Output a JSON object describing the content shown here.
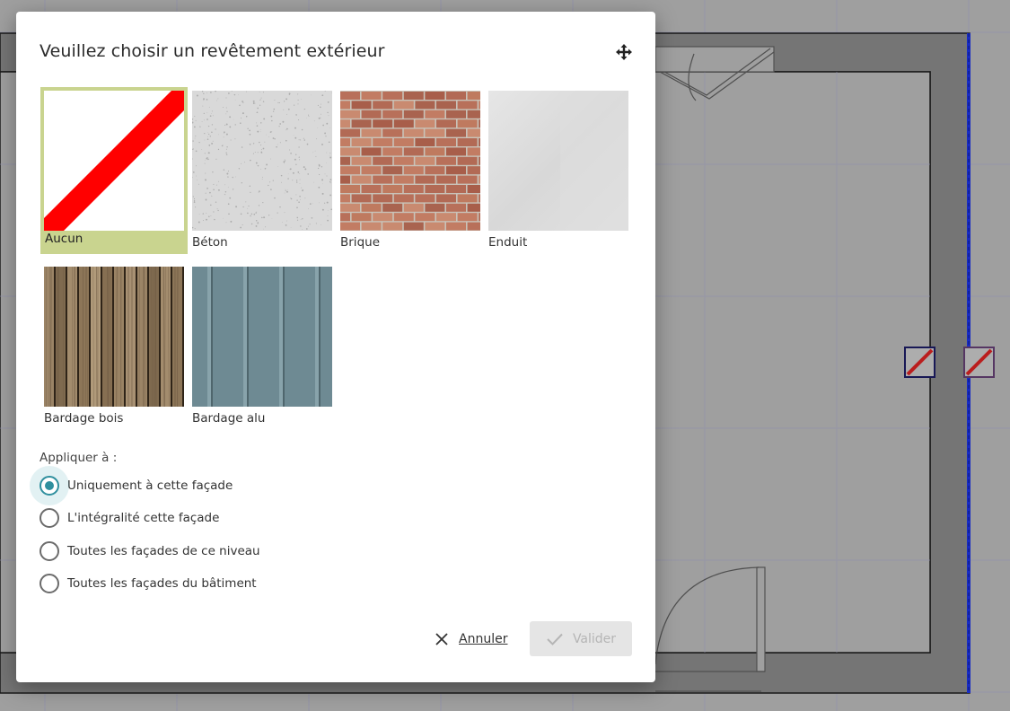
{
  "dialog": {
    "title": "Veuillez choisir un revêtement extérieur",
    "move_icon": "move-arrows-icon"
  },
  "materials": [
    {
      "label": "Aucun",
      "selected": true,
      "texture": "none-red-diagonal"
    },
    {
      "label": "Béton",
      "selected": false,
      "texture": "concrete"
    },
    {
      "label": "Brique",
      "selected": false,
      "texture": "brick"
    },
    {
      "label": "Enduit",
      "selected": false,
      "texture": "render"
    },
    {
      "label": "Bardage bois",
      "selected": false,
      "texture": "wood-cladding"
    },
    {
      "label": "Bardage alu",
      "selected": false,
      "texture": "aluminium-cladding"
    }
  ],
  "apply": {
    "label": "Appliquer à :",
    "options": [
      {
        "label": "Uniquement à cette façade",
        "checked": true
      },
      {
        "label": "L'intégralité cette façade",
        "checked": false
      },
      {
        "label": "Toutes les façades de ce niveau",
        "checked": false
      },
      {
        "label": "Toutes les façades du bâtiment",
        "checked": false
      }
    ]
  },
  "actions": {
    "cancel_label": "Annuler",
    "validate_label": "Valider",
    "validate_enabled": false
  },
  "colors": {
    "accent": "#2f8f9e",
    "selected_tile": "#c9d48f",
    "overlay_bg": "#a8a8a8"
  }
}
